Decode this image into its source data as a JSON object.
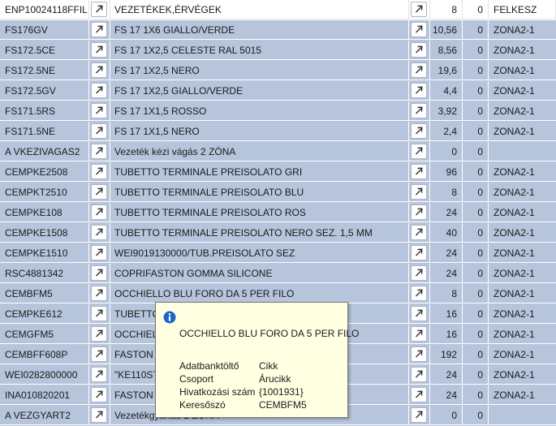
{
  "rows": [
    {
      "code": "ENP10024118FFIL",
      "desc": "VEZETÉKEK,ÉRVÉGEK",
      "qty": "8",
      "zero": "0",
      "zone": "FELKESZ"
    },
    {
      "code": "FS176GV",
      "desc": "FS 17 1X6 GIALLO/VERDE",
      "qty": "10,56",
      "zero": "0",
      "zone": "ZONA2-1"
    },
    {
      "code": "FS172.5CE",
      "desc": "FS 17 1X2,5 CELESTE RAL 5015",
      "qty": "8,56",
      "zero": "0",
      "zone": "ZONA2-1"
    },
    {
      "code": "FS172.5NE",
      "desc": "FS 17 1X2,5 NERO",
      "qty": "19,6",
      "zero": "0",
      "zone": "ZONA2-1"
    },
    {
      "code": "FS172.5GV",
      "desc": "FS 17 1X2,5 GIALLO/VERDE",
      "qty": "4,4",
      "zero": "0",
      "zone": "ZONA2-1"
    },
    {
      "code": "FS171.5RS",
      "desc": "FS 17 1X1,5 ROSSO",
      "qty": "3,92",
      "zero": "0",
      "zone": "ZONA2-1"
    },
    {
      "code": "FS171.5NE",
      "desc": "FS 17 1X1,5 NERO",
      "qty": "2,4",
      "zero": "0",
      "zone": "ZONA2-1"
    },
    {
      "code": "A VKEZIVAGAS2",
      "desc": "Vezeték kézi vágás 2 ZÓNA",
      "qty": "0",
      "zero": "0",
      "zone": ""
    },
    {
      "code": "CEMPKE2508",
      "desc": "TUBETTO TERMINALE PREISOLATO GRI",
      "qty": "96",
      "zero": "0",
      "zone": "ZONA2-1"
    },
    {
      "code": "CEMPKT2510",
      "desc": "TUBETTO TERMINALE PREISOLATO BLU",
      "qty": "8",
      "zero": "0",
      "zone": "ZONA2-1"
    },
    {
      "code": "CEMPKE108",
      "desc": "TUBETTO TERMINALE PREISOLATO ROS",
      "qty": "24",
      "zero": "0",
      "zone": "ZONA2-1"
    },
    {
      "code": "CEMPKE1508",
      "desc": "TUBETTO TERMINALE PREISOLATO NERO SEZ. 1,5 MM",
      "qty": "40",
      "zero": "0",
      "zone": "ZONA2-1"
    },
    {
      "code": "CEMPKE1510",
      "desc": "WEI9019130000/TUB.PREISOLATO SEZ",
      "qty": "24",
      "zero": "0",
      "zone": "ZONA2-1"
    },
    {
      "code": "RSC4881342",
      "desc": "COPRIFASTON GOMMA SILICONE",
      "qty": "24",
      "zero": "0",
      "zone": "ZONA2-1"
    },
    {
      "code": "CEMBFM5",
      "desc": "OCCHIELLO BLU FORO DA 5 PER FILO",
      "qty": "8",
      "zero": "0",
      "zone": "ZONA2-1"
    },
    {
      "code": "CEMPKE612",
      "desc": "TUBETTO",
      "qty": "16",
      "zero": "0",
      "zone": "ZONA2-1"
    },
    {
      "code": "CEMGFM5",
      "desc": "OCCHIEL",
      "qty": "16",
      "zero": "0",
      "zone": "ZONA2-1"
    },
    {
      "code": "CEMBFF608P",
      "desc": "FASTON B",
      "qty": "192",
      "zero": "0",
      "zone": "ZONA2-1"
    },
    {
      "code": "WEI0282800000",
      "desc": "\"KE110ST;                                                      m, Nem;\"",
      "qty": "24",
      "zero": "0",
      "zone": "ZONA2-1"
    },
    {
      "code": "INA010820201",
      "desc": "FASTON A",
      "qty": "24",
      "zero": "0",
      "zone": "ZONA2-1"
    },
    {
      "code": "A VEZGYART2",
      "desc": "Vezetékgyártás 2 ZÓNA",
      "qty": "0",
      "zero": "0",
      "zone": ""
    }
  ],
  "icons": {
    "row_button": "open-external-arrow-icon",
    "info": "info-icon"
  },
  "colors": {
    "row_bg": "#b6c5dc",
    "first_row_bg": "#ffffff",
    "tooltip_bg": "#ffffe1",
    "info_blue": "#1c64c8"
  },
  "tooltip": {
    "title": "OCCHIELLO BLU FORO DA 5 PER FILO",
    "fields": [
      {
        "label": "Adatbanktöltő",
        "value": "Cikk"
      },
      {
        "label": "Csoport",
        "value": "Árucikk"
      },
      {
        "label": "Hivatkozási szám",
        "value": "{1001931}"
      },
      {
        "label": "Keresőszó",
        "value": "CEMBFM5"
      }
    ]
  }
}
